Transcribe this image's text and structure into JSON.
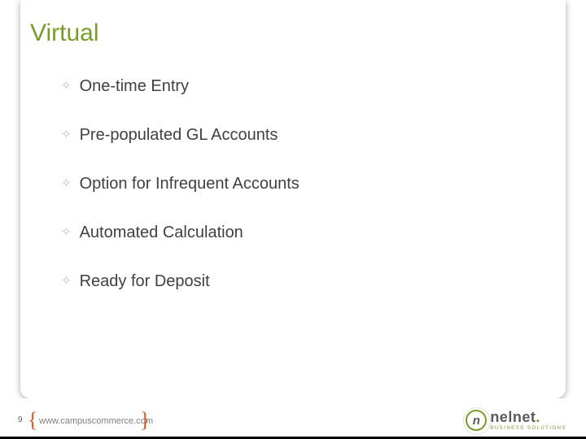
{
  "title": "Virtual",
  "bullets": [
    "One-time Entry",
    "Pre-populated GL Accounts",
    "Option for Infrequent Accounts",
    "Automated Calculation",
    "Ready for Deposit"
  ],
  "footer": {
    "page_number": "9",
    "url": "www.campuscommerce.com",
    "brand_name": "nelnet",
    "brand_sub": "BUSINESS SOLUTIONS"
  }
}
